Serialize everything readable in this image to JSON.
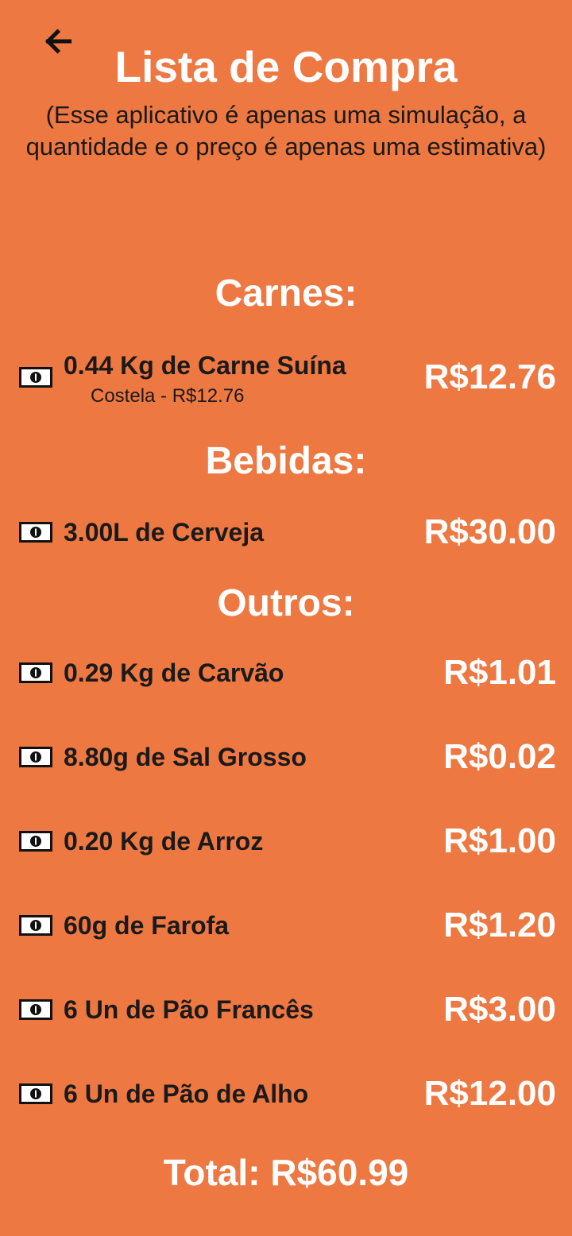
{
  "header": {
    "back_icon": "arrow-left-icon",
    "title": "Lista de Compra",
    "disclaimer": "(Esse aplicativo é apenas uma simulação, a quantidade e o preço é apenas uma estimativa)"
  },
  "sections": [
    {
      "label": "Carnes:",
      "items": [
        {
          "icon": "money-bill-icon",
          "name": "0.44 Kg de Carne Suína",
          "detail": "Costela - R$12.76",
          "price": "R$12.76"
        }
      ]
    },
    {
      "label": "Bebidas:",
      "items": [
        {
          "icon": "money-bill-icon",
          "name": "3.00L de Cerveja",
          "price": "R$30.00"
        }
      ]
    },
    {
      "label": "Outros:",
      "items": [
        {
          "icon": "money-bill-icon",
          "name": "0.29 Kg de Carvão",
          "price": "R$1.01"
        },
        {
          "icon": "money-bill-icon",
          "name": "8.80g de Sal Grosso",
          "price": "R$0.02"
        },
        {
          "icon": "money-bill-icon",
          "name": "0.20 Kg de Arroz",
          "price": "R$1.00"
        },
        {
          "icon": "money-bill-icon",
          "name": "60g de Farofa",
          "price": "R$1.20"
        },
        {
          "icon": "money-bill-icon",
          "name": "6 Un de Pão Francês",
          "price": "R$3.00"
        },
        {
          "icon": "money-bill-icon",
          "name": "6 Un de Pão de Alho",
          "price": "R$12.00"
        }
      ]
    }
  ],
  "total": "Total: R$60.99",
  "colors": {
    "background": "#EE7842",
    "accent_text": "#FFFFFF",
    "body_text": "#1A1A1A"
  }
}
